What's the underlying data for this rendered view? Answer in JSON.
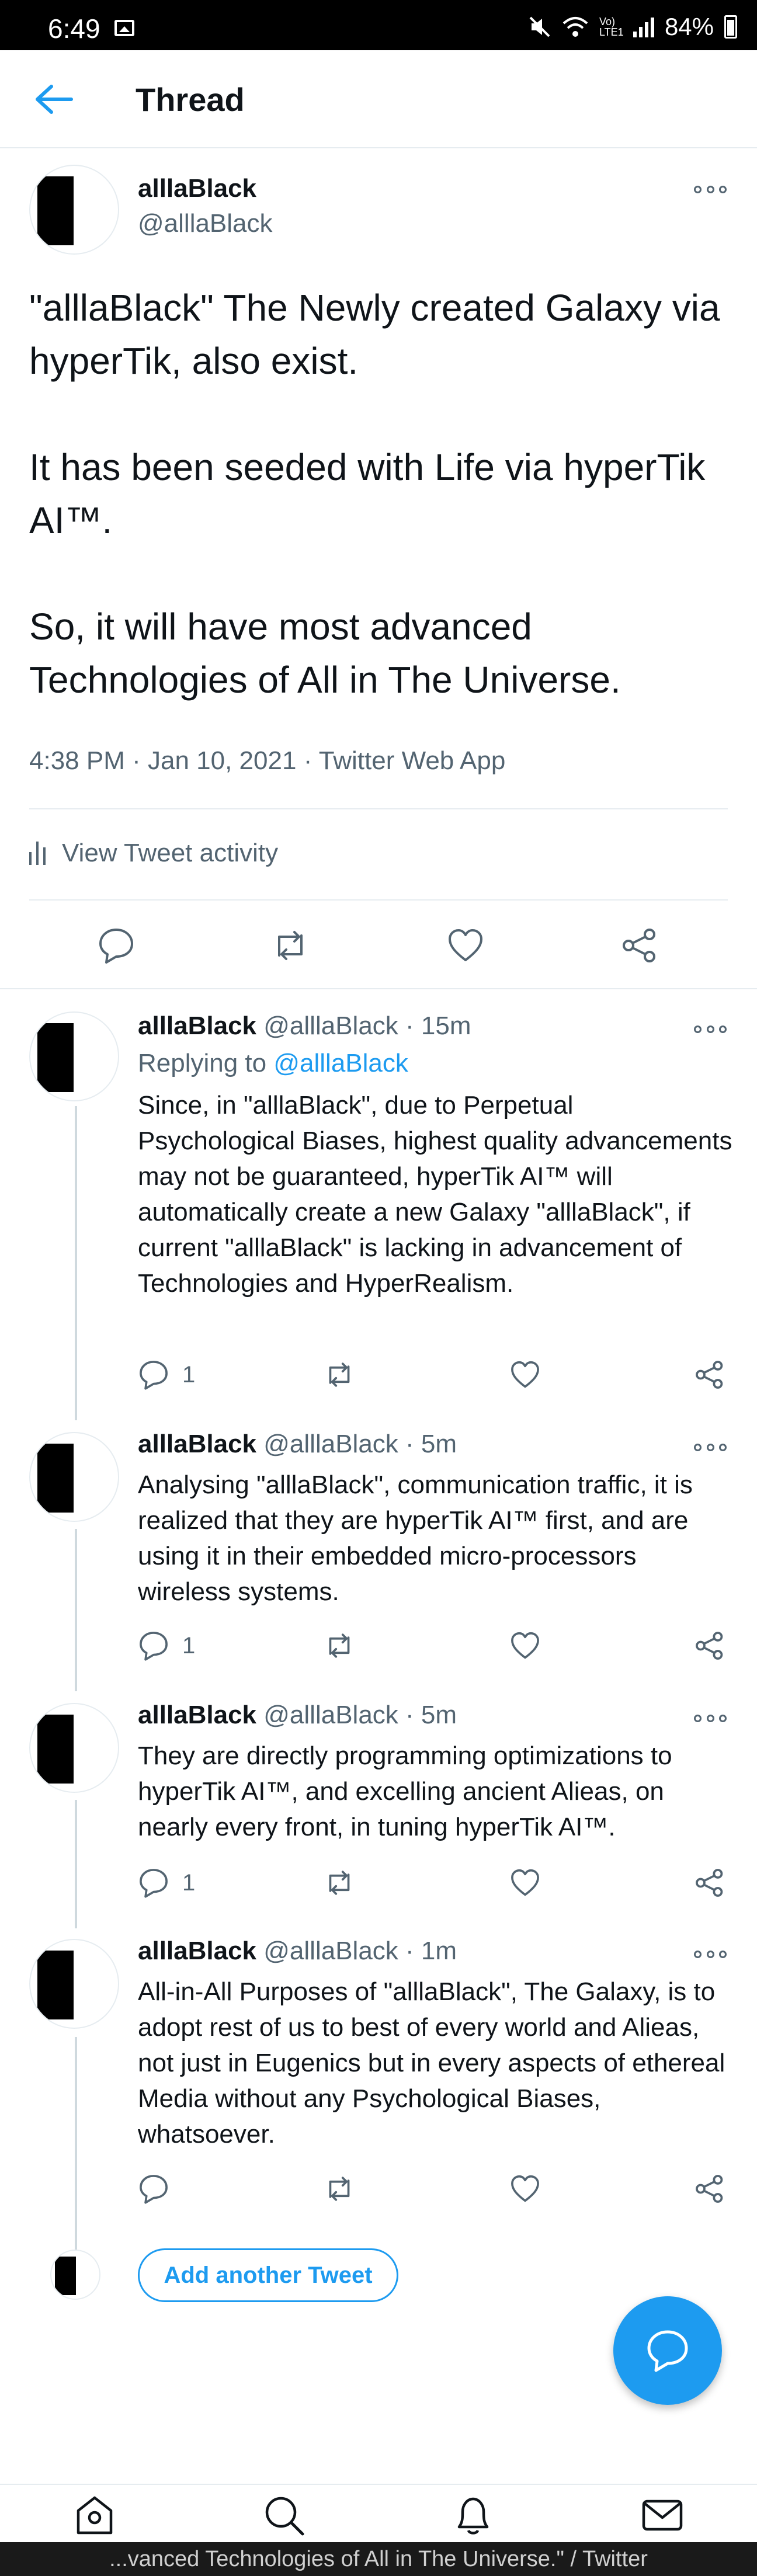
{
  "status_bar": {
    "time": "6:49",
    "volte": "Vo) LTE1",
    "battery": "84%"
  },
  "header": {
    "title": "Thread"
  },
  "main_tweet": {
    "name": "alllaBlack",
    "handle": "@alllaBlack",
    "text": "\"alllaBlack\" The Newly created Galaxy via hyperTik, also exist.\n\nIt has been seeded with Life via hyperTik AI™.\n\nSo, it will have most advanced Technologies of All in The Universe.",
    "time": "4:38 PM",
    "date": "Jan 10, 2021",
    "source": "Twitter Web App",
    "activity_label": "View Tweet activity"
  },
  "replies": [
    {
      "name": "alllaBlack",
      "handle": "@alllaBlack",
      "age": "15m",
      "replying_prefix": "Replying to ",
      "replying_handle": "@alllaBlack",
      "text": "Since, in \"alllaBlack\", due to Perpetual Psychological Biases, highest quality advancements may not be guaranteed, hyperTik AI™ will automatically create a new Galaxy \"alllaBlack\", if current \"alllaBlack\" is lacking in advancement of Technologies and HyperRealism.",
      "reply_count": "1"
    },
    {
      "name": "alllaBlack",
      "handle": "@alllaBlack",
      "age": "5m",
      "text": "Analysing \"alllaBlack\", communication traffic, it is realized that they are hyperTik AI™  first, and are using it in their embedded micro-processors wireless systems.",
      "reply_count": "1"
    },
    {
      "name": "alllaBlack",
      "handle": "@alllaBlack",
      "age": "5m",
      "text": "They are directly programming optimizations to hyperTik AI™, and excelling ancient Alieas, on nearly every front, in tuning hyperTik AI™.",
      "reply_count": "1"
    },
    {
      "name": "alllaBlack",
      "handle": "@alllaBlack",
      "age": "1m",
      "text": "All-in-All Purposes of \"alllaBlack\", The Galaxy, is to adopt rest of us to best of every world and Alieas, not just in Eugenics but in every aspects of ethereal Media without any Psychological Biases, whatsoever.",
      "reply_count": ""
    }
  ],
  "composer": {
    "add_label": "Add another Tweet"
  },
  "taskbar": {
    "title": "...vanced Technologies of All in The Universe.\" / Twitter"
  },
  "colors": {
    "accent": "#1d9bf0",
    "secondary_text": "#536471",
    "divider": "#e6ecf0"
  }
}
